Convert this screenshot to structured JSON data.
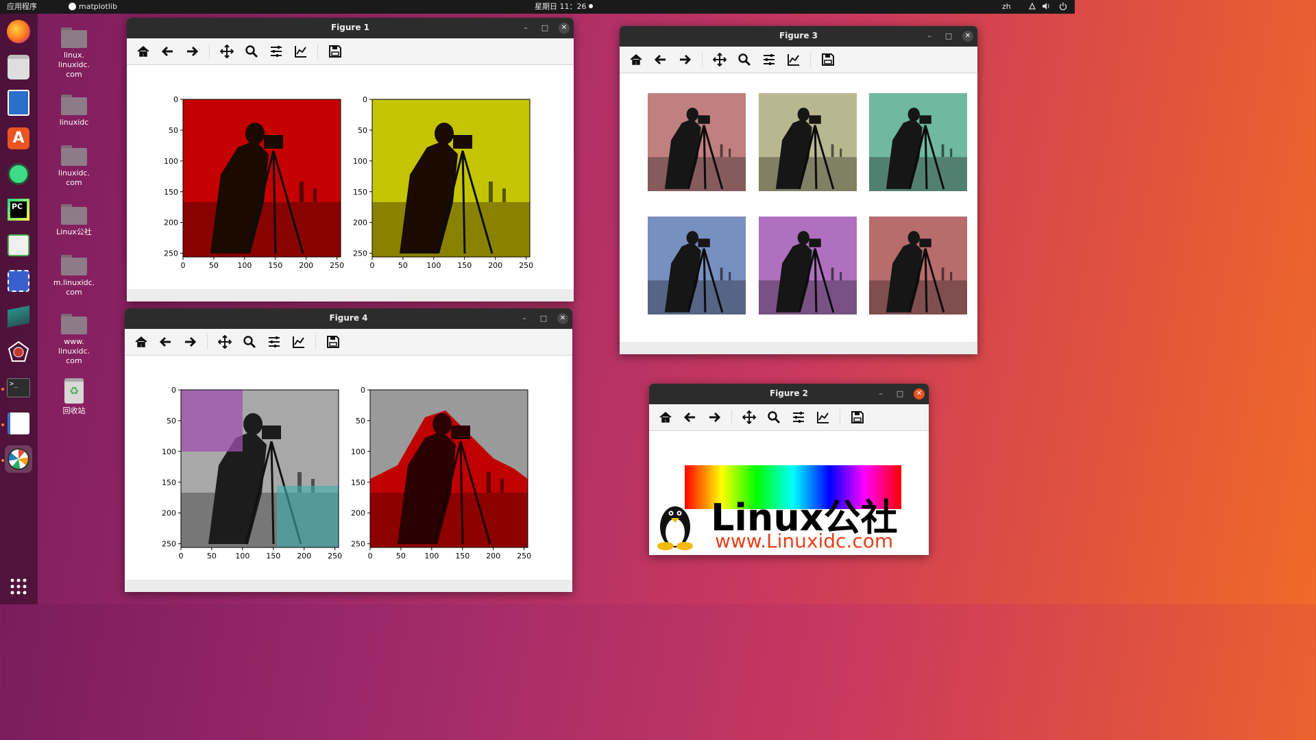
{
  "topbar": {
    "activities_label": "应用程序",
    "app_name": "matplotlib",
    "clock": "星期日 11：26",
    "input_method": "zh"
  },
  "desktop_icons": [
    {
      "label": "linux.\nlinuxidc.\ncom"
    },
    {
      "label": "linuxidc"
    },
    {
      "label": "linuxidc.\ncom"
    },
    {
      "label": "Linux公社"
    },
    {
      "label": "m.linuxidc.\ncom"
    },
    {
      "label": "www.\nlinuxidc.\ncom"
    },
    {
      "label": "回收站"
    }
  ],
  "dock_apps": [
    "Firefox",
    "Files",
    "LibreOffice Writer",
    "Ubuntu Software",
    "Android Studio",
    "PyCharm",
    "System Monitor",
    "Screenshot",
    "Sublime Text",
    "Network Tool",
    "Terminal",
    "Text Editor",
    "Python Figure"
  ],
  "windows": {
    "figure1": {
      "title": "Figure 1"
    },
    "figure2": {
      "title": "Figure 2"
    },
    "figure3": {
      "title": "Figure 3"
    },
    "figure4": {
      "title": "Figure 4"
    }
  },
  "toolbar_icons": [
    "home-icon",
    "back-icon",
    "forward-icon",
    "pan-icon",
    "zoom-icon",
    "configure-subplots-icon",
    "edit-axis-icon",
    "save-icon"
  ],
  "chart_data": [
    {
      "figure": "Figure 1",
      "type": "image",
      "panels": [
        {
          "tint": "#c40000",
          "ylim": [
            255,
            0
          ],
          "xlim": [
            0,
            255
          ]
        },
        {
          "tint": "#c4c400",
          "ylim": [
            255,
            0
          ],
          "xlim": [
            0,
            255
          ]
        }
      ],
      "xticks": [
        0,
        50,
        100,
        150,
        200,
        250
      ],
      "yticks": [
        0,
        50,
        100,
        150,
        200,
        250
      ]
    },
    {
      "figure": "Figure 3",
      "type": "image",
      "panels": [
        {
          "tint": "#c08080"
        },
        {
          "tint": "#b8b890"
        },
        {
          "tint": "#70b8a0"
        },
        {
          "tint": "#7890c0"
        },
        {
          "tint": "#b070c0"
        },
        {
          "tint": "#b86c6c"
        }
      ]
    },
    {
      "figure": "Figure 4",
      "type": "image",
      "panels": [
        {
          "base": "grayscale",
          "highlights": [
            {
              "region": "top-left",
              "tint": "#a050b0"
            },
            {
              "region": "bottom-right",
              "tint": "#40b0b0"
            }
          ]
        },
        {
          "base": "grayscale",
          "highlights": [
            {
              "region": "foreground",
              "tint": "#c00000"
            }
          ]
        }
      ],
      "xticks": [
        0,
        50,
        100,
        150,
        200,
        250
      ],
      "yticks": [
        0,
        50,
        100,
        150,
        200,
        250
      ]
    }
  ],
  "figure2": {
    "logo_text": "Linux公社",
    "logo_url": "www.Linuxidc.com"
  }
}
